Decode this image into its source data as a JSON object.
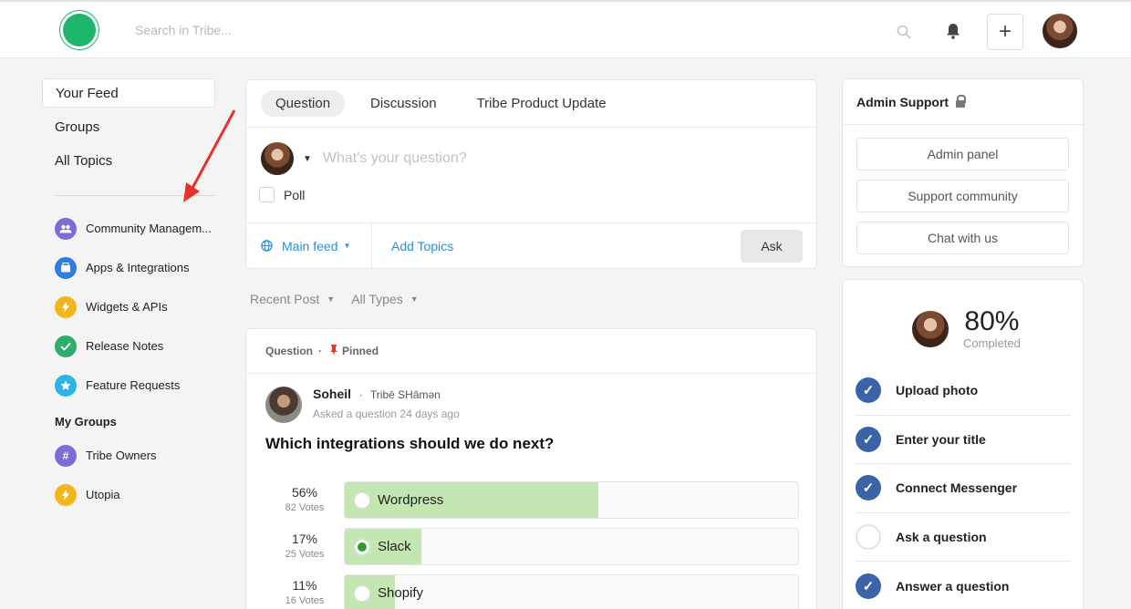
{
  "header": {
    "search_placeholder": "Search in Tribe...",
    "brand_color": "#1db66c"
  },
  "sidebar": {
    "nav": [
      {
        "label": "Your Feed"
      },
      {
        "label": "Groups"
      },
      {
        "label": "All Topics"
      }
    ],
    "topics": [
      {
        "label": "Community Managem...",
        "color": "#7e6cd4",
        "icon": "people-icon"
      },
      {
        "label": "Apps & Integrations",
        "color": "#2d7be3",
        "icon": "box-icon"
      },
      {
        "label": "Widgets & APIs",
        "color": "#f2b61b",
        "icon": "bolt-icon"
      },
      {
        "label": "Release Notes",
        "color": "#2fae6a",
        "icon": "check-icon"
      },
      {
        "label": "Feature Requests",
        "color": "#2cb3e8",
        "icon": "star-icon"
      }
    ],
    "my_groups_title": "My Groups",
    "groups": [
      {
        "label": "Tribe Owners",
        "color": "#7e6cd4",
        "icon": "hash-icon"
      },
      {
        "label": "Utopia",
        "color": "#f2b61b",
        "icon": "bolt-icon"
      }
    ]
  },
  "composer": {
    "tabs": [
      "Question",
      "Discussion",
      "Tribe Product Update"
    ],
    "placeholder": "What's your question?",
    "poll_label": "Poll",
    "feed_label": "Main feed",
    "add_topics_label": "Add Topics",
    "ask_label": "Ask"
  },
  "filters": {
    "sort": "Recent Post",
    "type": "All Types"
  },
  "post": {
    "type": "Question",
    "pinned": "Pinned",
    "author": "Soheil",
    "author_role": "Tribē SHāmən",
    "meta": "Asked a question 24 days ago",
    "title": "Which integrations should we do next?",
    "options": [
      {
        "pct": "56%",
        "votes": "82 Votes",
        "label": "Wordpress",
        "fraction": 0.56,
        "selected": false
      },
      {
        "pct": "17%",
        "votes": "25 Votes",
        "label": "Slack",
        "fraction": 0.17,
        "selected": true
      },
      {
        "pct": "11%",
        "votes": "16 Votes",
        "label": "Shopify",
        "fraction": 0.11,
        "selected": false
      }
    ]
  },
  "admin": {
    "title": "Admin Support",
    "buttons": [
      "Admin panel",
      "Support community",
      "Chat with us"
    ]
  },
  "progress": {
    "percent": "80%",
    "label": "Completed",
    "steps": [
      {
        "label": "Upload photo",
        "done": true
      },
      {
        "label": "Enter your title",
        "done": true
      },
      {
        "label": "Connect Messenger",
        "done": true
      },
      {
        "label": "Ask a question",
        "done": false
      },
      {
        "label": "Answer a question",
        "done": true
      }
    ]
  }
}
